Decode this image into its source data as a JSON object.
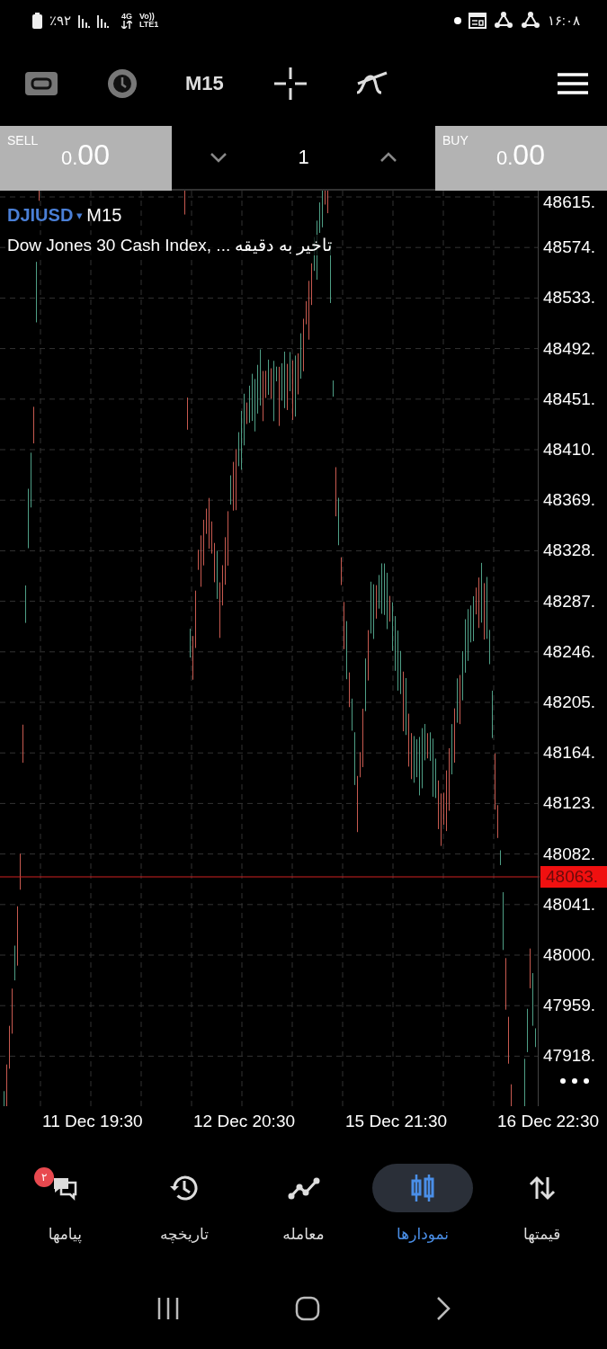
{
  "status_bar": {
    "battery": "٪۹۲",
    "network": "4G",
    "volte": "Vo))",
    "lte": "LTE1",
    "time": "۱۶:۰۸"
  },
  "toolbar": {
    "timeframe": "M15"
  },
  "trade_bar": {
    "sell": {
      "label": "SELL",
      "price_small": "0.",
      "price_large": "00"
    },
    "volume": "1",
    "buy": {
      "label": "BUY",
      "price_small": "0.",
      "price_large": "00"
    }
  },
  "chart": {
    "symbol": "DJIUSD",
    "caret": "▾",
    "timeframe": "M15",
    "description": "Dow Jones 30 Cash Index, ... تاخیر به دقیقه",
    "price_labels": [
      "48615.",
      "48574.",
      "48533.",
      "48492.",
      "48451.",
      "48410.",
      "48369.",
      "48328.",
      "48287.",
      "48246.",
      "48205.",
      "48164.",
      "48123.",
      "48082.",
      "48041.",
      "48000.",
      "47959.",
      "47918."
    ],
    "current_price": "48063.",
    "time_labels": [
      "11 Dec 19:30",
      "12 Dec 20:30",
      "15 Dec 21:30",
      "16 Dec 22:30"
    ]
  },
  "bottom_nav": [
    {
      "label": "قیمتها",
      "kind": "quotes",
      "selected": false
    },
    {
      "label": "نمودارها",
      "kind": "charts",
      "selected": true
    },
    {
      "label": "معامله",
      "kind": "trade",
      "selected": false
    },
    {
      "label": "تاریخچه",
      "kind": "history",
      "selected": false
    },
    {
      "label": "پیامها",
      "kind": "messages",
      "selected": false,
      "badge": "۲"
    }
  ]
}
